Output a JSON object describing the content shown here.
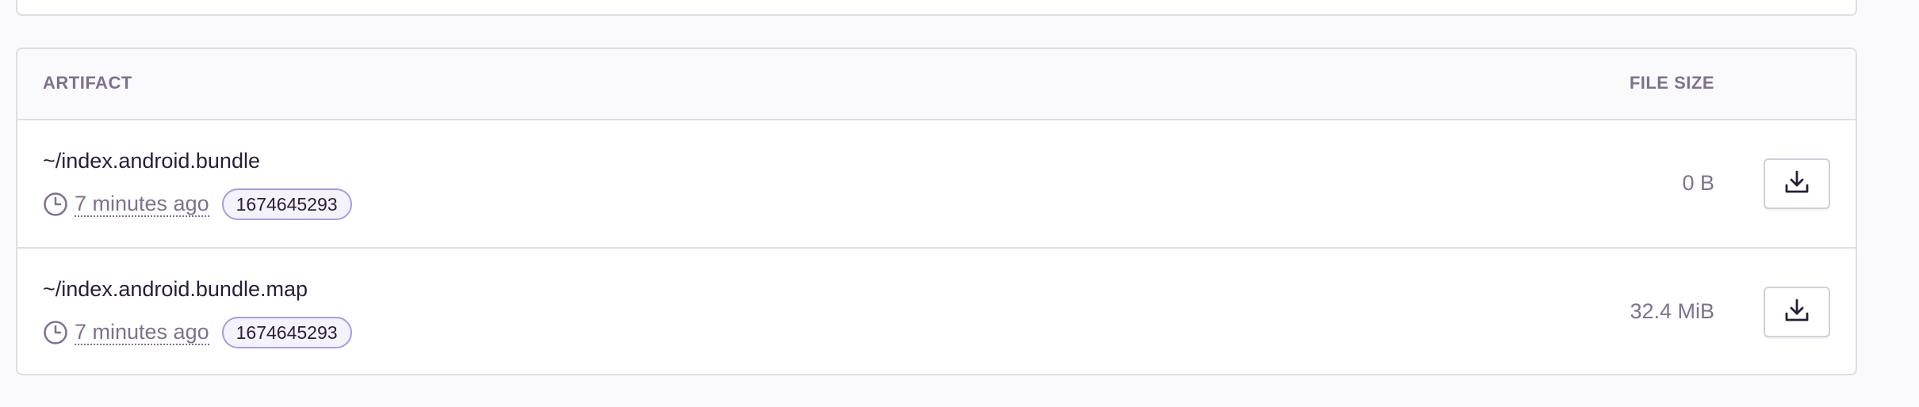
{
  "table": {
    "headers": {
      "artifact": "ARTIFACT",
      "file_size": "FILE SIZE"
    },
    "rows": [
      {
        "name": "~/index.android.bundle",
        "time_ago": "7 minutes ago",
        "tag": "1674645293",
        "size": "0 B",
        "action_icon": "download-icon",
        "meta_icon": "clock-icon"
      },
      {
        "name": "~/index.android.bundle.map",
        "time_ago": "7 minutes ago",
        "tag": "1674645293",
        "size": "32.4 MiB",
        "action_icon": "download-icon",
        "meta_icon": "clock-icon"
      }
    ]
  },
  "colors": {
    "background": "#faf9fb",
    "border": "#e0dce5",
    "text": "#2b1d38",
    "muted": "#80708f",
    "tag_border": "#a99be0",
    "tag_bg": "#f4f2fb"
  }
}
